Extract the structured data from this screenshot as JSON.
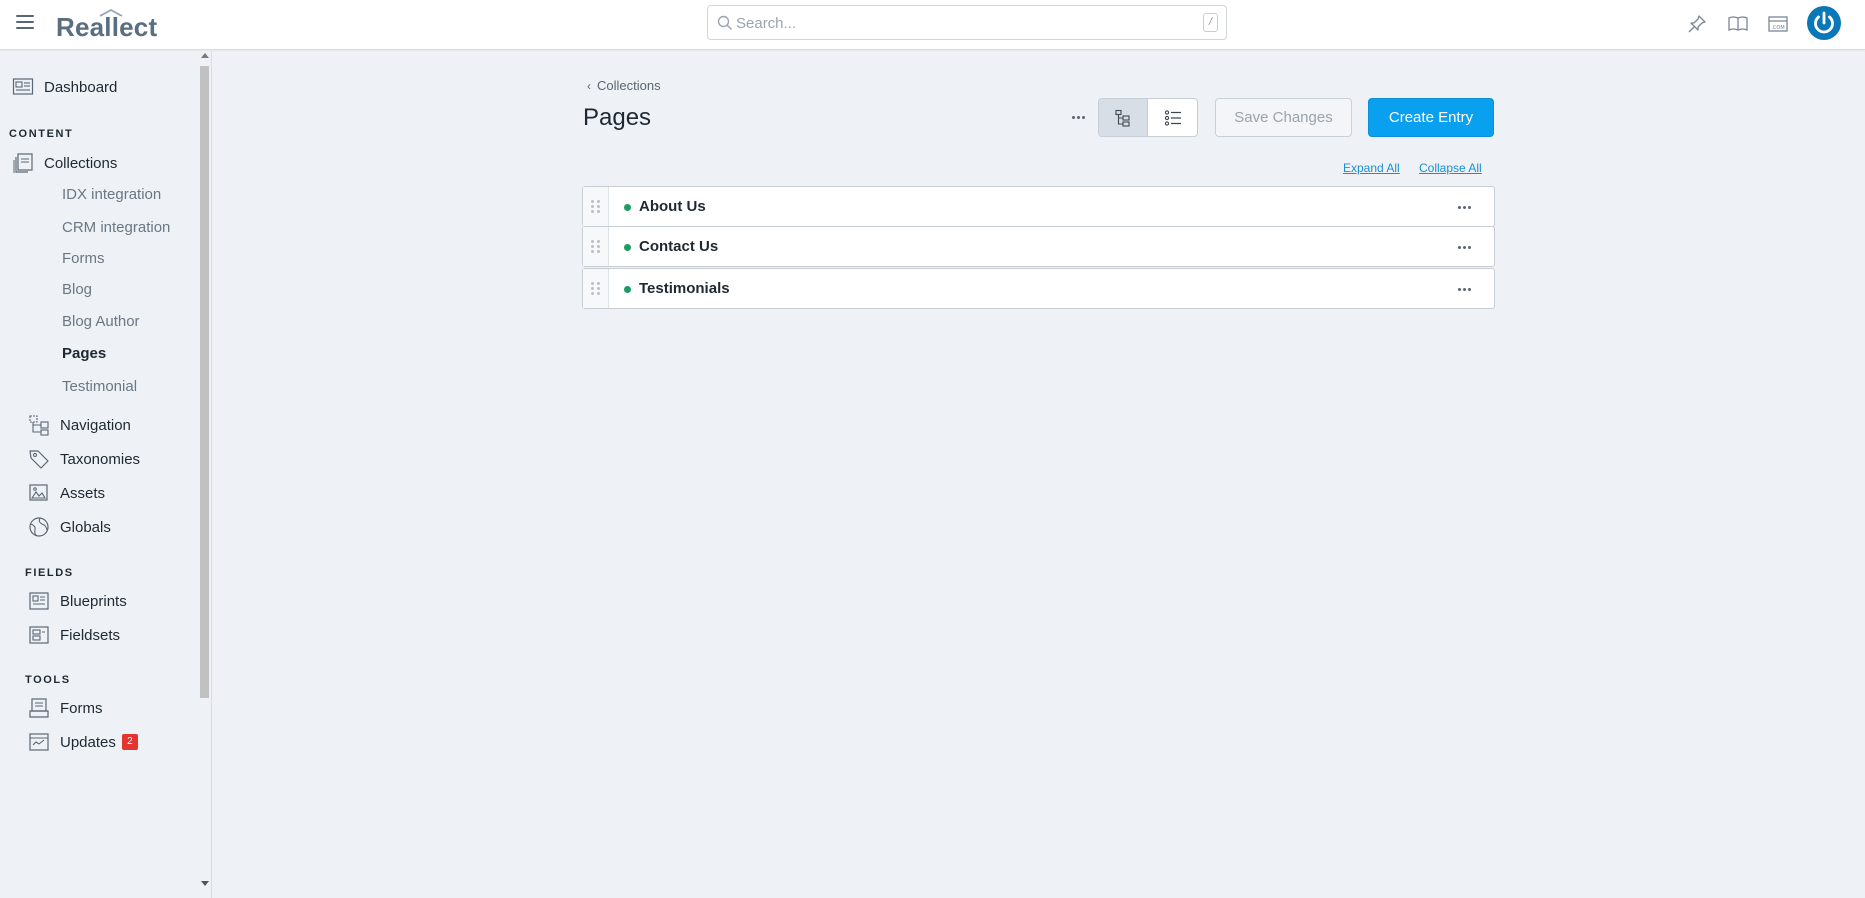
{
  "app": {
    "logo_text": "Reallect",
    "search_placeholder": "Search...",
    "search_value": "",
    "search_shortcut": "/"
  },
  "topbar_icons": [
    "pin-icon",
    "book-icon",
    "site-icon",
    "power-avatar-icon"
  ],
  "sidebar": {
    "dashboard": "Dashboard",
    "content_label": "CONTENT",
    "collections": "Collections",
    "collection_items": [
      {
        "label": "IDX integration",
        "active": false
      },
      {
        "label": "CRM integration",
        "active": false
      },
      {
        "label": "Forms",
        "active": false
      },
      {
        "label": "Blog",
        "active": false
      },
      {
        "label": "Blog Author",
        "active": false
      },
      {
        "label": "Pages",
        "active": true
      },
      {
        "label": "Testimonial",
        "active": false
      }
    ],
    "navigation": "Navigation",
    "taxonomies": "Taxonomies",
    "assets": "Assets",
    "globals": "Globals",
    "fields_label": "FIELDS",
    "blueprints": "Blueprints",
    "fieldsets": "Fieldsets",
    "tools_label": "TOOLS",
    "forms": "Forms",
    "updates": "Updates",
    "updates_badge": "2"
  },
  "main": {
    "breadcrumb": "Collections",
    "title": "Pages",
    "save_label": "Save Changes",
    "create_label": "Create Entry",
    "expand_all": "Expand All",
    "collapse_all": "Collapse All",
    "entries": [
      {
        "title": "About Us",
        "status": "published"
      },
      {
        "title": "Contact Us",
        "status": "published"
      },
      {
        "title": "Testimonials",
        "status": "published"
      }
    ]
  },
  "colors": {
    "accent": "#0aa0f0",
    "published_dot": "#1c9b62",
    "badge": "#e3342f",
    "avatar": "#0a78b8"
  }
}
